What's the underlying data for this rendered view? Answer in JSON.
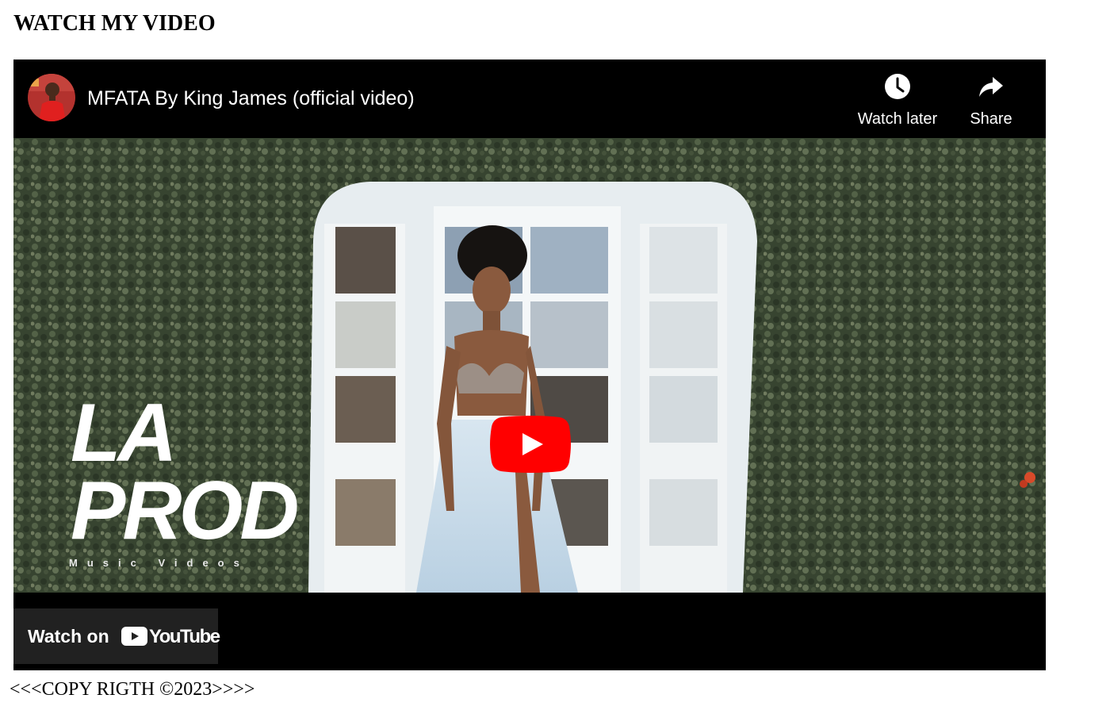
{
  "page": {
    "heading": "WATCH MY VIDEO",
    "footer": "<<<COPY RIGTH ©2023>>>>"
  },
  "player": {
    "video_title": "MFATA By King James (official video)",
    "actions": {
      "watch_later_label": "Watch later",
      "share_label": "Share"
    },
    "thumbnail": {
      "logo_line1": "LA",
      "logo_line2": "PROD",
      "logo_subtitle": "Music Videos"
    },
    "watch_on": {
      "label": "Watch on",
      "brand": "YouTube"
    },
    "colors": {
      "play_button": "#ff0000",
      "player_background": "#000000",
      "watch_on_background": "#212121"
    },
    "icons": {
      "watch_later": "clock-icon",
      "share": "share-arrow-icon",
      "play": "play-icon",
      "brand": "youtube-logo-icon"
    }
  }
}
